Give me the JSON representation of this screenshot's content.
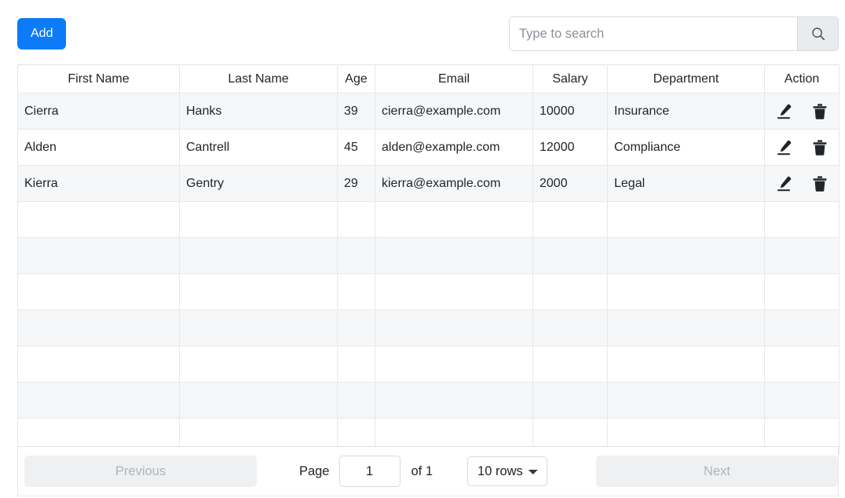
{
  "toolbar": {
    "add_label": "Add",
    "search_placeholder": "Type to search",
    "search_value": "",
    "search_icon": "search-icon",
    "accent_color": "#0d7bf7"
  },
  "table": {
    "columns": [
      {
        "key": "first_name",
        "label": "First Name"
      },
      {
        "key": "last_name",
        "label": "Last Name"
      },
      {
        "key": "age",
        "label": "Age"
      },
      {
        "key": "email",
        "label": "Email"
      },
      {
        "key": "salary",
        "label": "Salary"
      },
      {
        "key": "department",
        "label": "Department"
      },
      {
        "key": "action",
        "label": "Action"
      }
    ],
    "rows": [
      {
        "first_name": "Cierra",
        "last_name": "Hanks",
        "age": "39",
        "email": "cierra@example.com",
        "salary": "10000",
        "department": "Insurance"
      },
      {
        "first_name": "Alden",
        "last_name": "Cantrell",
        "age": "45",
        "email": "alden@example.com",
        "salary": "12000",
        "department": "Compliance"
      },
      {
        "first_name": "Kierra",
        "last_name": "Gentry",
        "age": "29",
        "email": "kierra@example.com",
        "salary": "2000",
        "department": "Legal"
      }
    ],
    "empty_row_count": 7,
    "row_actions": {
      "edit_icon": "pencil-icon",
      "delete_icon": "trash-icon"
    }
  },
  "pagination": {
    "previous_label": "Previous",
    "previous_disabled": true,
    "page_label": "Page",
    "page_value": "1",
    "of_label": "of 1",
    "rows_per_page_selected": "10 rows",
    "rows_per_page_options": [
      "10 rows"
    ],
    "next_label": "Next",
    "next_disabled": true
  }
}
